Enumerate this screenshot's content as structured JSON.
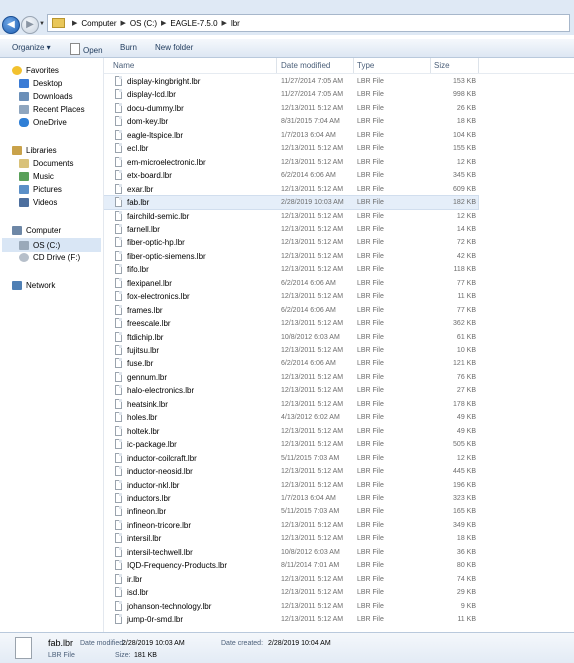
{
  "address": {
    "crumbs": [
      "Computer",
      "OS (C:)",
      "EAGLE-7.5.0",
      "lbr"
    ]
  },
  "toolbar": {
    "organize": "Organize ▾",
    "open": "Open",
    "burn": "Burn",
    "new_folder": "New folder"
  },
  "nav": {
    "favorites": "Favorites",
    "desktop": "Desktop",
    "downloads": "Downloads",
    "recent": "Recent Places",
    "onedrive": "OneDrive",
    "libraries": "Libraries",
    "documents": "Documents",
    "music": "Music",
    "pictures": "Pictures",
    "videos": "Videos",
    "computer": "Computer",
    "os": "OS (C:)",
    "cd": "CD Drive (F:)",
    "network": "Network"
  },
  "columns": {
    "name": "Name",
    "date": "Date modified",
    "type": "Type",
    "size": "Size"
  },
  "files": [
    {
      "name": "display-kingbright.lbr",
      "date": "11/27/2014 7:05 AM",
      "type": "LBR File",
      "size": "153 KB"
    },
    {
      "name": "display-lcd.lbr",
      "date": "11/27/2014 7:05 AM",
      "type": "LBR File",
      "size": "998 KB"
    },
    {
      "name": "docu-dummy.lbr",
      "date": "12/13/2011 5:12 AM",
      "type": "LBR File",
      "size": "26 KB"
    },
    {
      "name": "dom-key.lbr",
      "date": "8/31/2015 7:04 AM",
      "type": "LBR File",
      "size": "18 KB"
    },
    {
      "name": "eagle-ltspice.lbr",
      "date": "1/7/2013 6:04 AM",
      "type": "LBR File",
      "size": "104 KB"
    },
    {
      "name": "ecl.lbr",
      "date": "12/13/2011 5:12 AM",
      "type": "LBR File",
      "size": "155 KB"
    },
    {
      "name": "em-microelectronic.lbr",
      "date": "12/13/2011 5:12 AM",
      "type": "LBR File",
      "size": "12 KB"
    },
    {
      "name": "etx-board.lbr",
      "date": "6/2/2014 6:06 AM",
      "type": "LBR File",
      "size": "345 KB"
    },
    {
      "name": "exar.lbr",
      "date": "12/13/2011 5:12 AM",
      "type": "LBR File",
      "size": "609 KB"
    },
    {
      "name": "fab.lbr",
      "date": "2/28/2019 10:03 AM",
      "type": "LBR File",
      "size": "182 KB"
    },
    {
      "name": "fairchild-semic.lbr",
      "date": "12/13/2011 5:12 AM",
      "type": "LBR File",
      "size": "12 KB"
    },
    {
      "name": "farnell.lbr",
      "date": "12/13/2011 5:12 AM",
      "type": "LBR File",
      "size": "14 KB"
    },
    {
      "name": "fiber-optic-hp.lbr",
      "date": "12/13/2011 5:12 AM",
      "type": "LBR File",
      "size": "72 KB"
    },
    {
      "name": "fiber-optic-siemens.lbr",
      "date": "12/13/2011 5:12 AM",
      "type": "LBR File",
      "size": "42 KB"
    },
    {
      "name": "fifo.lbr",
      "date": "12/13/2011 5:12 AM",
      "type": "LBR File",
      "size": "118 KB"
    },
    {
      "name": "flexipanel.lbr",
      "date": "6/2/2014 6:06 AM",
      "type": "LBR File",
      "size": "77 KB"
    },
    {
      "name": "fox-electronics.lbr",
      "date": "12/13/2011 5:12 AM",
      "type": "LBR File",
      "size": "11 KB"
    },
    {
      "name": "frames.lbr",
      "date": "6/2/2014 6:06 AM",
      "type": "LBR File",
      "size": "77 KB"
    },
    {
      "name": "freescale.lbr",
      "date": "12/13/2011 5:12 AM",
      "type": "LBR File",
      "size": "362 KB"
    },
    {
      "name": "ftdichip.lbr",
      "date": "10/8/2012 6:03 AM",
      "type": "LBR File",
      "size": "61 KB"
    },
    {
      "name": "fujitsu.lbr",
      "date": "12/13/2011 5:12 AM",
      "type": "LBR File",
      "size": "10 KB"
    },
    {
      "name": "fuse.lbr",
      "date": "6/2/2014 6:06 AM",
      "type": "LBR File",
      "size": "121 KB"
    },
    {
      "name": "gennum.lbr",
      "date": "12/13/2011 5:12 AM",
      "type": "LBR File",
      "size": "76 KB"
    },
    {
      "name": "halo-electronics.lbr",
      "date": "12/13/2011 5:12 AM",
      "type": "LBR File",
      "size": "27 KB"
    },
    {
      "name": "heatsink.lbr",
      "date": "12/13/2011 5:12 AM",
      "type": "LBR File",
      "size": "178 KB"
    },
    {
      "name": "holes.lbr",
      "date": "4/13/2012 6:02 AM",
      "type": "LBR File",
      "size": "49 KB"
    },
    {
      "name": "holtek.lbr",
      "date": "12/13/2011 5:12 AM",
      "type": "LBR File",
      "size": "49 KB"
    },
    {
      "name": "ic-package.lbr",
      "date": "12/13/2011 5:12 AM",
      "type": "LBR File",
      "size": "505 KB"
    },
    {
      "name": "inductor-coilcraft.lbr",
      "date": "5/11/2015 7:03 AM",
      "type": "LBR File",
      "size": "12 KB"
    },
    {
      "name": "inductor-neosid.lbr",
      "date": "12/13/2011 5:12 AM",
      "type": "LBR File",
      "size": "445 KB"
    },
    {
      "name": "inductor-nkl.lbr",
      "date": "12/13/2011 5:12 AM",
      "type": "LBR File",
      "size": "196 KB"
    },
    {
      "name": "inductors.lbr",
      "date": "1/7/2013 6:04 AM",
      "type": "LBR File",
      "size": "323 KB"
    },
    {
      "name": "infineon.lbr",
      "date": "5/11/2015 7:03 AM",
      "type": "LBR File",
      "size": "165 KB"
    },
    {
      "name": "infineon-tricore.lbr",
      "date": "12/13/2011 5:12 AM",
      "type": "LBR File",
      "size": "349 KB"
    },
    {
      "name": "intersil.lbr",
      "date": "12/13/2011 5:12 AM",
      "type": "LBR File",
      "size": "18 KB"
    },
    {
      "name": "intersil-techwell.lbr",
      "date": "10/8/2012 6:03 AM",
      "type": "LBR File",
      "size": "36 KB"
    },
    {
      "name": "IQD-Frequency-Products.lbr",
      "date": "8/11/2014 7:01 AM",
      "type": "LBR File",
      "size": "80 KB"
    },
    {
      "name": "ir.lbr",
      "date": "12/13/2011 5:12 AM",
      "type": "LBR File",
      "size": "74 KB"
    },
    {
      "name": "isd.lbr",
      "date": "12/13/2011 5:12 AM",
      "type": "LBR File",
      "size": "29 KB"
    },
    {
      "name": "johanson-technology.lbr",
      "date": "12/13/2011 5:12 AM",
      "type": "LBR File",
      "size": "9 KB"
    },
    {
      "name": "jump-0r-smd.lbr",
      "date": "12/13/2011 5:12 AM",
      "type": "LBR File",
      "size": "11 KB"
    }
  ],
  "details": {
    "name": "fab.lbr",
    "type": "LBR File",
    "date_modified_label": "Date modified:",
    "date_modified": "2/28/2019 10:03 AM",
    "date_created_label": "Date created:",
    "date_created": "2/28/2019 10:04 AM",
    "size_label": "Size:",
    "size": "181 KB"
  }
}
